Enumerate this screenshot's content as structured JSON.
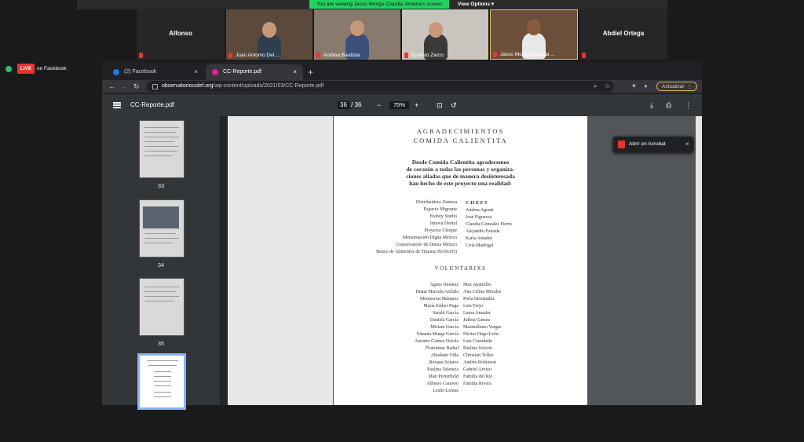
{
  "zoom": {
    "banner": "You are viewing Jasso Monge Claudia Ximena's screen",
    "view_options": "View Options",
    "participants": [
      {
        "name": "Alfonso"
      },
      {
        "name": "Juan Antonio Del ..."
      },
      {
        "name": "Andrea Bautista"
      },
      {
        "name": "Ernesto Zarco"
      },
      {
        "name": "Jasso Monge Claudia ..."
      },
      {
        "name": "Abdiel Ortega"
      }
    ]
  },
  "live": {
    "badge": "LIVE",
    "text": "on Facebook"
  },
  "browser": {
    "tabs": [
      {
        "label": "(2) Facebook",
        "close": "×"
      },
      {
        "label": "CC-Reporte.pdf",
        "close": "×"
      }
    ],
    "new_tab": "+",
    "url_host": "observatoriocolef.org",
    "url_path": "/wp-content/uploads/2021/03/CC-Reporte.pdf",
    "update_button": "Actualizar",
    "colors": {
      "update_border": "#d9b15a",
      "facebook": "#1877f2",
      "pdf_tab": "#e91e8c"
    }
  },
  "pdf": {
    "title": "CC-Reporte.pdf",
    "page_current": "36",
    "page_sep": "/",
    "page_total": "36",
    "zoom": "75%",
    "thumbnails": [
      "33",
      "34",
      "35"
    ],
    "acrobat": {
      "label": "Abrir en Acrobat",
      "close": "×"
    },
    "page_content": {
      "title_1": "AGRADECIMIENTOS",
      "title_2": "COMIDA CALIENTITA",
      "intro": [
        "Desde Comida Calientita agradecemos",
        "de corazón a todas las personas y organiza-",
        "ciones aliadas que de manera desinteresada",
        "han hecho de este proyecto una realidad:"
      ],
      "orgs": [
        "Distribuidora Zamora",
        "Espacio Migrante",
        "Eraboy Studio",
        "Innova Dental",
        "Proyecto Choque",
        "Menstruación Digna México",
        "Conservatorio de Danza México",
        "Banco de Alimentos de Tijuana (BANATI)"
      ],
      "chefs_heading": "CHEFS",
      "chefs": [
        "Andrea Aguari",
        "José Figueroa",
        "Claudia González Fierro",
        "Alejandro Estrada",
        "Karla Amador",
        "Liria Madrigal"
      ],
      "voluntarios_heading": "VOLUNTARIXS",
      "vol_left": [
        "Agnes Jiménez",
        "Diana Marcela Archila",
        "Montserrat Márquez",
        "María Esther Puga",
        "Sarahí García",
        "Daniela García",
        "Miriam García",
        "Ximena Murga García",
        "Antonio Gómez Dávila",
        "Florentino Badial",
        "Abraham Villa",
        "Roxana Solares",
        "Paulina Valencia",
        "Matt Porterfield",
        "Alfonso Caraveo",
        "Leslie Lemus"
      ],
      "vol_right": [
        "Max Jaramillo",
        "Ana Celina Morales",
        "Perla Hernández",
        "Luis Trejo",
        "Laura Amador",
        "Julieta Gámez",
        "Maximiliano Vargas",
        "Héctor Hugo León",
        "Luis Castañeda",
        "Paulina Solorio",
        "Christian Téllez",
        "Andrés Robinson",
        "Gabriel Arvizu",
        "Familia del Río",
        "Familia Rivera"
      ]
    }
  }
}
